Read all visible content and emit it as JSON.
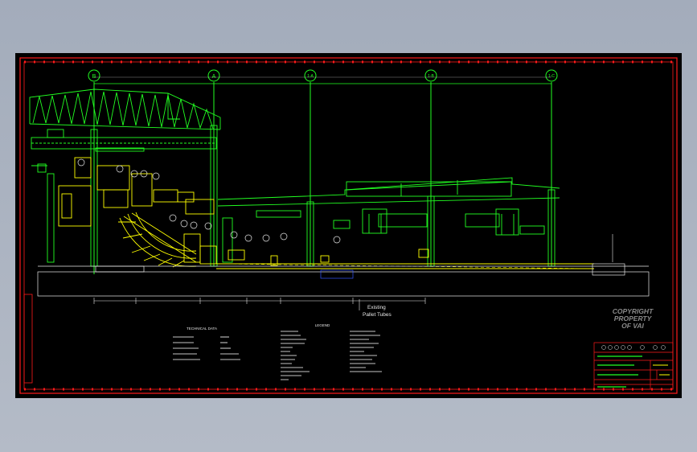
{
  "axes": {
    "labels": [
      "B",
      "A",
      "1-A",
      "1-B",
      "1-C"
    ]
  },
  "annotations": {
    "existing_line1": "Existing",
    "existing_line2": "Pallet Tubes"
  },
  "copyright": {
    "line1": "COPYRIGHT",
    "line2": "PROPERTY",
    "line3": "OF VAI"
  },
  "sections": {
    "technical_data_heading": "TECHNICAL DATA",
    "legend_heading": "LEGEND"
  },
  "colors": {
    "sheet_background": "#000000",
    "border": "#ff1a1a",
    "structure": "#22ff22",
    "equipment": "#ffff00",
    "text": "#e8e8e8",
    "viewport": "#a9b1bf"
  }
}
